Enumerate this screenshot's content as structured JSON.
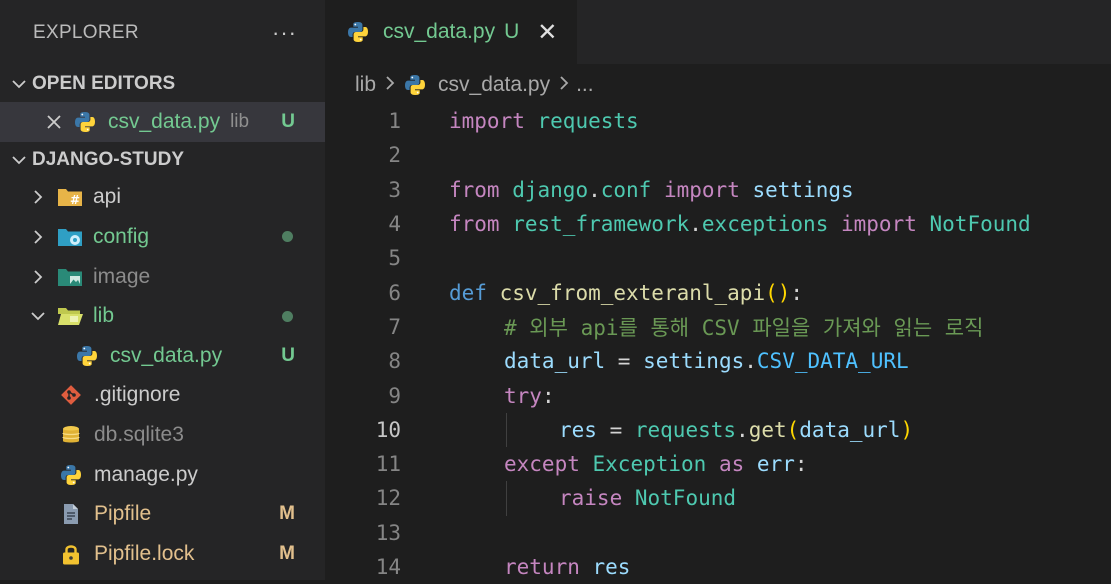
{
  "explorer": {
    "title": "EXPLORER",
    "more": "···"
  },
  "open_editors": {
    "title": "OPEN EDITORS",
    "item": {
      "name": "csv_data.py",
      "folder": "lib",
      "status": "U"
    }
  },
  "workspace": {
    "title": "DJANGO-STUDY",
    "items": [
      {
        "name": "api"
      },
      {
        "name": "config"
      },
      {
        "name": "image"
      },
      {
        "name": "lib"
      },
      {
        "name": "csv_data.py",
        "status": "U"
      },
      {
        "name": ".gitignore"
      },
      {
        "name": "db.sqlite3"
      },
      {
        "name": "manage.py"
      },
      {
        "name": "Pipfile",
        "status": "M"
      },
      {
        "name": "Pipfile.lock",
        "status": "M"
      }
    ]
  },
  "tab": {
    "name": "csv_data.py",
    "status": "U",
    "close": "✕"
  },
  "breadcrumb": {
    "folder": "lib",
    "file": "csv_data.py",
    "more": "..."
  },
  "editor": {
    "line_numbers": [
      "1",
      "2",
      "3",
      "4",
      "5",
      "6",
      "7",
      "8",
      "9",
      "10",
      "11",
      "12",
      "13",
      "14"
    ],
    "code": {
      "l1": {
        "import": "import",
        "module": "requests"
      },
      "l3": {
        "from": "from",
        "pkg": "django",
        "dot": ".",
        "sub": "conf",
        "import": "import",
        "name": "settings"
      },
      "l4": {
        "from": "from",
        "pkg": "rest_framework",
        "dot": ".",
        "sub": "exceptions",
        "import": "import",
        "name": "NotFound"
      },
      "l6": {
        "def": "def",
        "fn": "csv_from_exteranl_api",
        "open": "(",
        "close": ")",
        "colon": ":"
      },
      "l7": {
        "comment": "# 외부 api를 통해 CSV 파일을 가져와 읽는 로직"
      },
      "l8": {
        "var": "data_url",
        "eq": " = ",
        "obj": "settings",
        "dot": ".",
        "attr": "CSV_DATA_URL"
      },
      "l9": {
        "kw": "try",
        "colon": ":"
      },
      "l10": {
        "var": "res",
        "eq": " = ",
        "obj": "requests",
        "dot": ".",
        "fn": "get",
        "open": "(",
        "arg": "data_url",
        "close": ")"
      },
      "l11": {
        "kw": "except",
        "cls": "Exception",
        "as": "as",
        "var": "err",
        "colon": ":"
      },
      "l12": {
        "kw": "raise",
        "cls": "NotFound"
      },
      "l14": {
        "kw": "return",
        "var": "res"
      }
    }
  },
  "colors": {
    "untracked": "#73c991",
    "modified": "#e2c08d",
    "python_blue": "#3b77a8",
    "python_yellow": "#ffd43b"
  }
}
